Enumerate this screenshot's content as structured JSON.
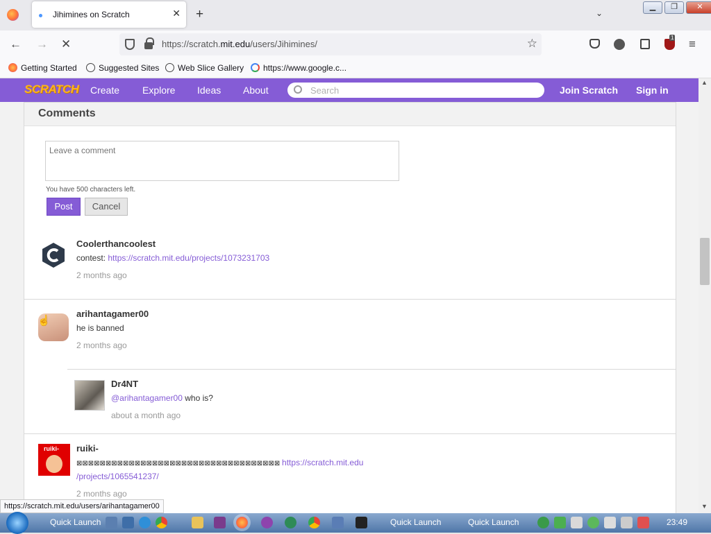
{
  "browser": {
    "tab_title": "Jihimines on Scratch",
    "tab_close": "✕",
    "new_tab": "+",
    "tab_list": "⌄",
    "url_host": "https://scratch.",
    "url_domain": "mit.edu",
    "url_path": "/users/Jihimines/",
    "star": "☆",
    "back": "←",
    "forward": "→",
    "stop": "✕",
    "menu": "≡",
    "extensions_badge": "1",
    "bookmarks": [
      "Getting Started",
      "Suggested Sites",
      "Web Slice Gallery",
      "https://www.google.c..."
    ],
    "status_url": "https://scratch.mit.edu/users/arihantagamer00"
  },
  "scratch_nav": {
    "logo": "SCRATCH",
    "items": [
      "Create",
      "Explore",
      "Ideas",
      "About"
    ],
    "search_placeholder": "Search",
    "join": "Join Scratch",
    "sign_in": "Sign in"
  },
  "comments": {
    "title": "Comments",
    "placeholder": "Leave a comment",
    "chars_left": "You have 500 characters left.",
    "post": "Post",
    "cancel": "Cancel",
    "items": [
      {
        "user": "Coolerthancoolest",
        "prefix": "contest: ",
        "link": "https://scratch.mit.edu/projects/1073231703",
        "time": "2 months ago"
      },
      {
        "user": "arihantagamer00",
        "text": "he is banned",
        "time": "2 months ago"
      },
      {
        "user": "Dr4NT",
        "mention": "@arihantagamer00",
        "text": " who is?",
        "time": "about a month ago"
      },
      {
        "user": "ruiki-",
        "garbled": "⊠⊠⊠⊠⊠⊠⊠⊠⊠⊠⊠⊠⊠⊠⊠⊠⊠⊠⊠⊠⊠⊠⊠⊠⊠⊠⊠⊠⊠⊠⊠⊠⊠⊠⊠ ",
        "link1": "https://scratch.mit.edu",
        "link2": "/projects/1065541237/",
        "time": "2 months ago",
        "avatar_text": "ruiki-"
      }
    ]
  },
  "taskbar": {
    "quick_launch": "Quick Launch",
    "quick_launch_2": "Quick Launch",
    "quick_launch_3": "Quick Launch",
    "clock": "23:49"
  },
  "colors": {
    "scratch_purple": "#855cd6",
    "link": "#855cd6"
  }
}
